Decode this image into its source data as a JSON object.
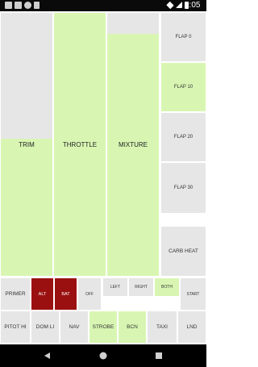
{
  "status": {
    "time": "9:05"
  },
  "sliders": {
    "trim": {
      "label": "TRIM",
      "level": 0.52
    },
    "throttle": {
      "label": "THROTTLE",
      "level": 1.0
    },
    "mixture": {
      "label": "MIXTURE",
      "level": 0.92
    }
  },
  "flaps": {
    "flap0": "FLAP 0",
    "flap10": "FLAP 10",
    "flap20": "FLAP 20",
    "flap30": "FLAP 30"
  },
  "carb_heat": "CARB HEAT",
  "magneto_row": {
    "primer": "PRIMER",
    "alt": "ALT",
    "bat": "BAT",
    "off": "OFF",
    "left": "LEFT",
    "right": "RIGHT",
    "both": "BOTH",
    "start": "START"
  },
  "switch_row": {
    "pitot": "PITOT HI",
    "dom": "DOM LI",
    "nav": "NAV",
    "strobe": "STROBE",
    "bcn": "BCN",
    "taxi": "TAXI",
    "lnd": "LND"
  },
  "colors": {
    "active_green": "#d8f6b2",
    "inactive_gray": "#e6e6e6",
    "on_red": "#9a1010"
  }
}
